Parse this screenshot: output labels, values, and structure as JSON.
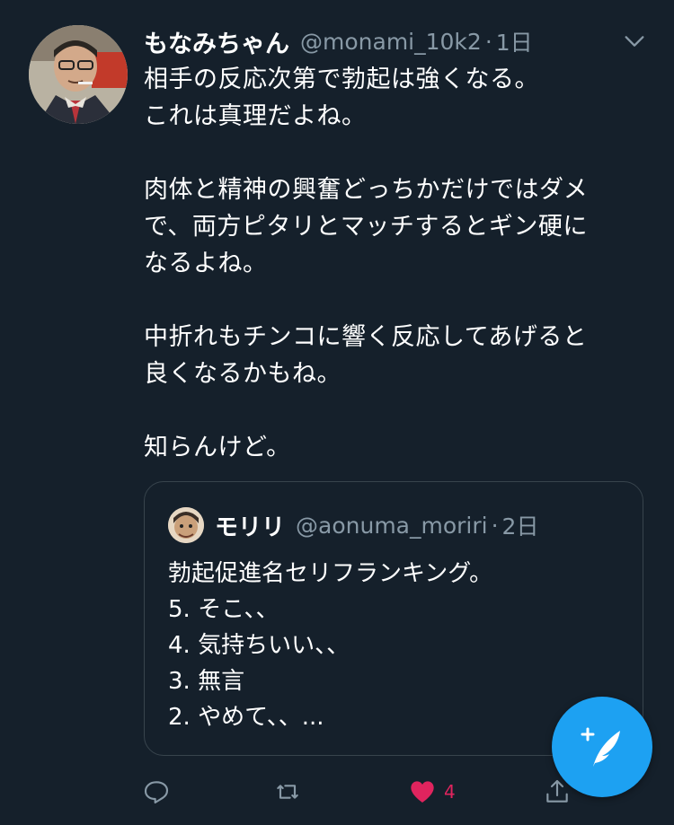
{
  "tweet": {
    "name": "もなみちゃん",
    "handle": "@monami_10k2",
    "separator": "·",
    "time": "1日",
    "lines": [
      "相手の反応次第で勃起は強くなる。",
      "これは真理だよね。",
      "",
      "肉体と精神の興奮どっちかだけではダメ",
      "で、両方ピタリとマッチするとギン硬に",
      "なるよね。",
      "",
      "中折れもチンコに響く反応してあげると",
      "良くなるかもね。",
      "",
      "知らんけど。"
    ]
  },
  "quote": {
    "name": "モリリ",
    "handle": "@aonuma_moriri",
    "separator": "·",
    "time": "2日",
    "lines": [
      "勃起促進名セリフランキング。",
      "5. そこ、、",
      "4. 気持ちいい、、",
      "3. 無言",
      "2. やめて、、..."
    ]
  },
  "actions": {
    "like_count": "4",
    "like_color": "#e0245e",
    "accent": "#1da1f2"
  },
  "icons": [
    "reply-icon",
    "retweet-icon",
    "heart-icon",
    "share-icon",
    "compose-icon",
    "chevron-down-icon"
  ]
}
